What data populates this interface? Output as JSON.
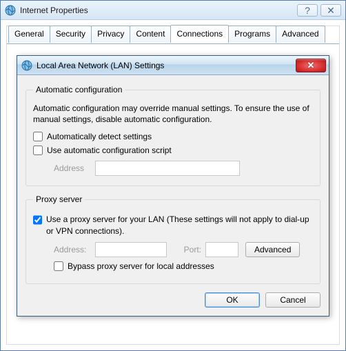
{
  "parentWindow": {
    "title": "Internet Properties",
    "tabs": [
      "General",
      "Security",
      "Privacy",
      "Content",
      "Connections",
      "Programs",
      "Advanced"
    ],
    "activeTab": "Connections"
  },
  "dialog": {
    "title": "Local Area Network (LAN) Settings",
    "autoConfig": {
      "legend": "Automatic configuration",
      "desc": "Automatic configuration may override manual settings.  To ensure the use of manual settings, disable automatic configuration.",
      "autoDetect": {
        "label": "Automatically detect settings",
        "checked": false
      },
      "useScript": {
        "label": "Use automatic configuration script",
        "checked": false
      },
      "addressLabel": "Address",
      "addressValue": ""
    },
    "proxy": {
      "legend": "Proxy server",
      "useProxy": {
        "label": "Use a proxy server for your LAN (These settings will not apply to dial-up or VPN connections).",
        "checked": true
      },
      "addressLabel": "Address:",
      "addressValue": "",
      "portLabel": "Port:",
      "portValue": "",
      "advanced": "Advanced",
      "bypass": {
        "label": "Bypass proxy server for local addresses",
        "checked": false
      }
    },
    "buttons": {
      "ok": "OK",
      "cancel": "Cancel"
    }
  }
}
